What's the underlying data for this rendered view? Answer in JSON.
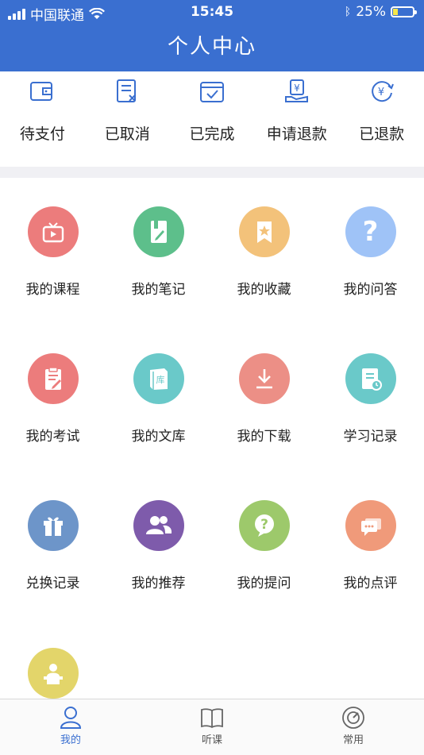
{
  "status_bar": {
    "carrier": "中国联通",
    "time": "15:45",
    "battery": "25%",
    "battery_level": 0.25
  },
  "header": {
    "title": "个人中心"
  },
  "orders": [
    {
      "label": "待支付",
      "icon": "wallet-icon"
    },
    {
      "label": "已取消",
      "icon": "cancelled-doc-icon"
    },
    {
      "label": "已完成",
      "icon": "completed-check-icon"
    },
    {
      "label": "申请退款",
      "icon": "refund-hand-icon"
    },
    {
      "label": "已退款",
      "icon": "yuan-refund-icon"
    }
  ],
  "menu": [
    {
      "label": "我的课程",
      "icon": "tv-icon",
      "color": "#ec7c7c"
    },
    {
      "label": "我的笔记",
      "icon": "note-icon",
      "color": "#5dbf8b"
    },
    {
      "label": "我的收藏",
      "icon": "bookmark-star-icon",
      "color": "#f3c27a"
    },
    {
      "label": "我的问答",
      "icon": "question-icon",
      "color": "#9fc3f7"
    },
    {
      "label": "我的考试",
      "icon": "exam-icon",
      "color": "#ec7c7c"
    },
    {
      "label": "我的文库",
      "icon": "library-icon",
      "color": "#6ac9c9"
    },
    {
      "label": "我的下载",
      "icon": "download-icon",
      "color": "#ec8f86"
    },
    {
      "label": "学习记录",
      "icon": "study-record-icon",
      "color": "#6ac9c9"
    },
    {
      "label": "兑换记录",
      "icon": "gift-icon",
      "color": "#6d95c9"
    },
    {
      "label": "我的推荐",
      "icon": "users-icon",
      "color": "#7e5bab"
    },
    {
      "label": "我的提问",
      "icon": "ask-bubble-icon",
      "color": "#9dc96b"
    },
    {
      "label": "我的点评",
      "icon": "comment-icon",
      "color": "#f09a7a"
    },
    {
      "label": "",
      "icon": "lecturer-icon",
      "color": "#e3d56a"
    }
  ],
  "tabbar": [
    {
      "label": "我的",
      "icon": "user-icon",
      "active": true
    },
    {
      "label": "听课",
      "icon": "book-icon",
      "active": false
    },
    {
      "label": "常用",
      "icon": "dashboard-icon",
      "active": false
    }
  ],
  "colors": {
    "primary": "#3a6fd0",
    "divider": "#f0f0f4"
  }
}
